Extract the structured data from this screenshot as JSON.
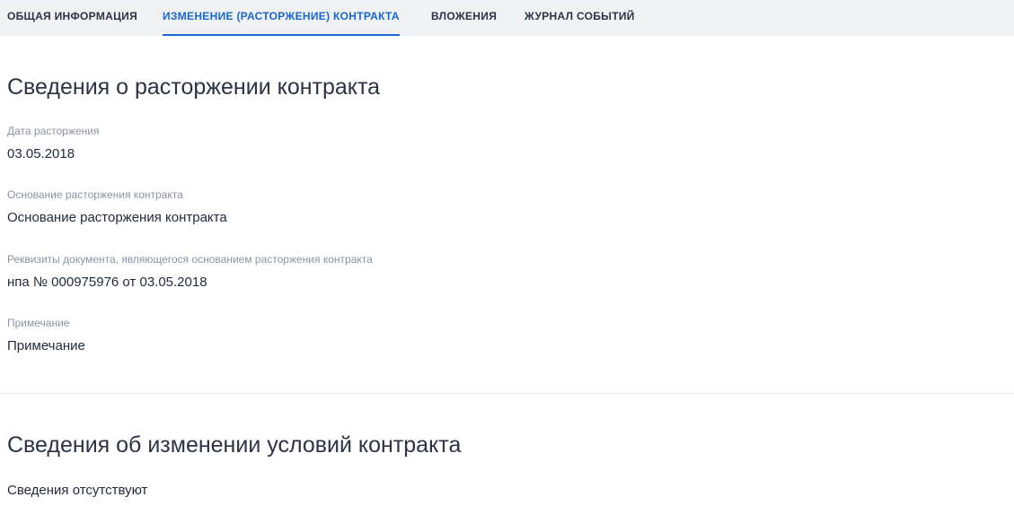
{
  "tabs": [
    {
      "label": "ОБЩАЯ ИНФОРМАЦИЯ",
      "active": false
    },
    {
      "label": "ИЗМЕНЕНИЕ (РАСТОРЖЕНИЕ) КОНТРАКТА",
      "active": true
    },
    {
      "label": "ВЛОЖЕНИЯ",
      "active": false
    },
    {
      "label": "ЖУРНАЛ СОБЫТИЙ",
      "active": false
    }
  ],
  "termination": {
    "title": "Сведения о расторжении контракта",
    "fields": [
      {
        "label": "Дата расторжения",
        "value": "03.05.2018"
      },
      {
        "label": "Основание расторжения контракта",
        "value": "Основание расторжения контракта"
      },
      {
        "label": "Реквизиты документа, являющегося основанием расторжения контракта",
        "value": "нпа № 000975976 от 03.05.2018"
      },
      {
        "label": "Примечание",
        "value": "Примечание"
      }
    ]
  },
  "changes": {
    "title": "Сведения об изменении условий контракта",
    "empty_text": "Сведения отсутствуют"
  },
  "colors": {
    "accent": "#1766d6",
    "tabbar_bg": "#f0f1f2",
    "label": "#8a93a3",
    "text": "#1f2a3c"
  }
}
